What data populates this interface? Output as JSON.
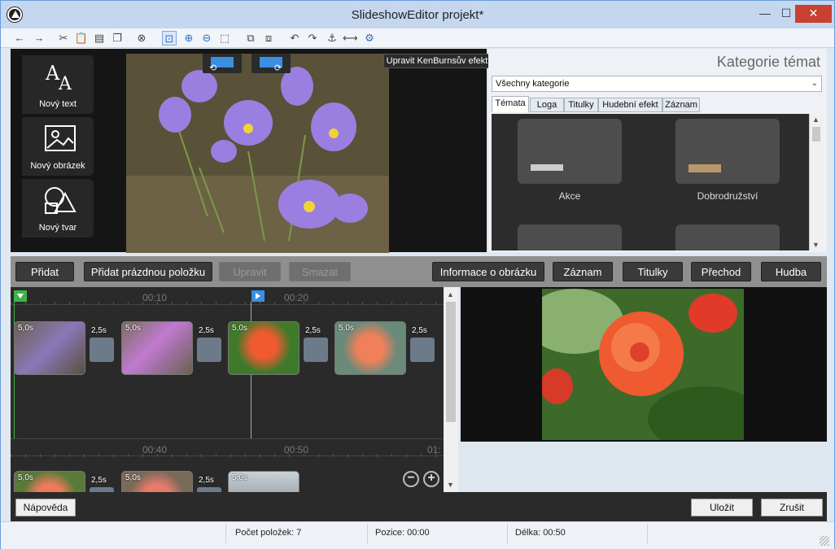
{
  "window": {
    "title": "SlideshowEditor projekt*"
  },
  "tools": {
    "new_text": "Nový text",
    "new_image": "Nový obrázek",
    "new_shape": "Nový tvar"
  },
  "preview": {
    "kenburns_label": "Upravit KenBurnsův efekt"
  },
  "categories": {
    "title": "Kategorie témat",
    "selected": "Všechny kategorie",
    "tabs": [
      "Témata",
      "Loga",
      "Titulky",
      "Hudební efekt",
      "Záznam"
    ],
    "themes": [
      "Akce",
      "Dobrodružství"
    ]
  },
  "actions": {
    "add": "Přidat",
    "add_empty": "Přidat prázdnou položku",
    "edit": "Upravit",
    "delete": "Smazat",
    "image_info": "Informace o obrázku",
    "record": "Záznam",
    "subtitles": "Titulky",
    "transition": "Přechod",
    "music": "Hudba"
  },
  "timeline": {
    "row1_marks": [
      "00:10",
      "00:20"
    ],
    "row2_marks": [
      "00:40",
      "00:50",
      "01:"
    ],
    "clip_duration": "5,0s",
    "transition_duration": "2,5s"
  },
  "bottom": {
    "help": "Nápověda",
    "save": "Uložit",
    "cancel": "Zrušit"
  },
  "status": {
    "count": "Počet položek: 7",
    "position": "Pozice: 00:00",
    "length": "Délka: 00:50"
  },
  "colors": {
    "accent": "#3a8fe0",
    "marker_green": "#3cb44b",
    "marker_blue": "#3a8fe0"
  }
}
